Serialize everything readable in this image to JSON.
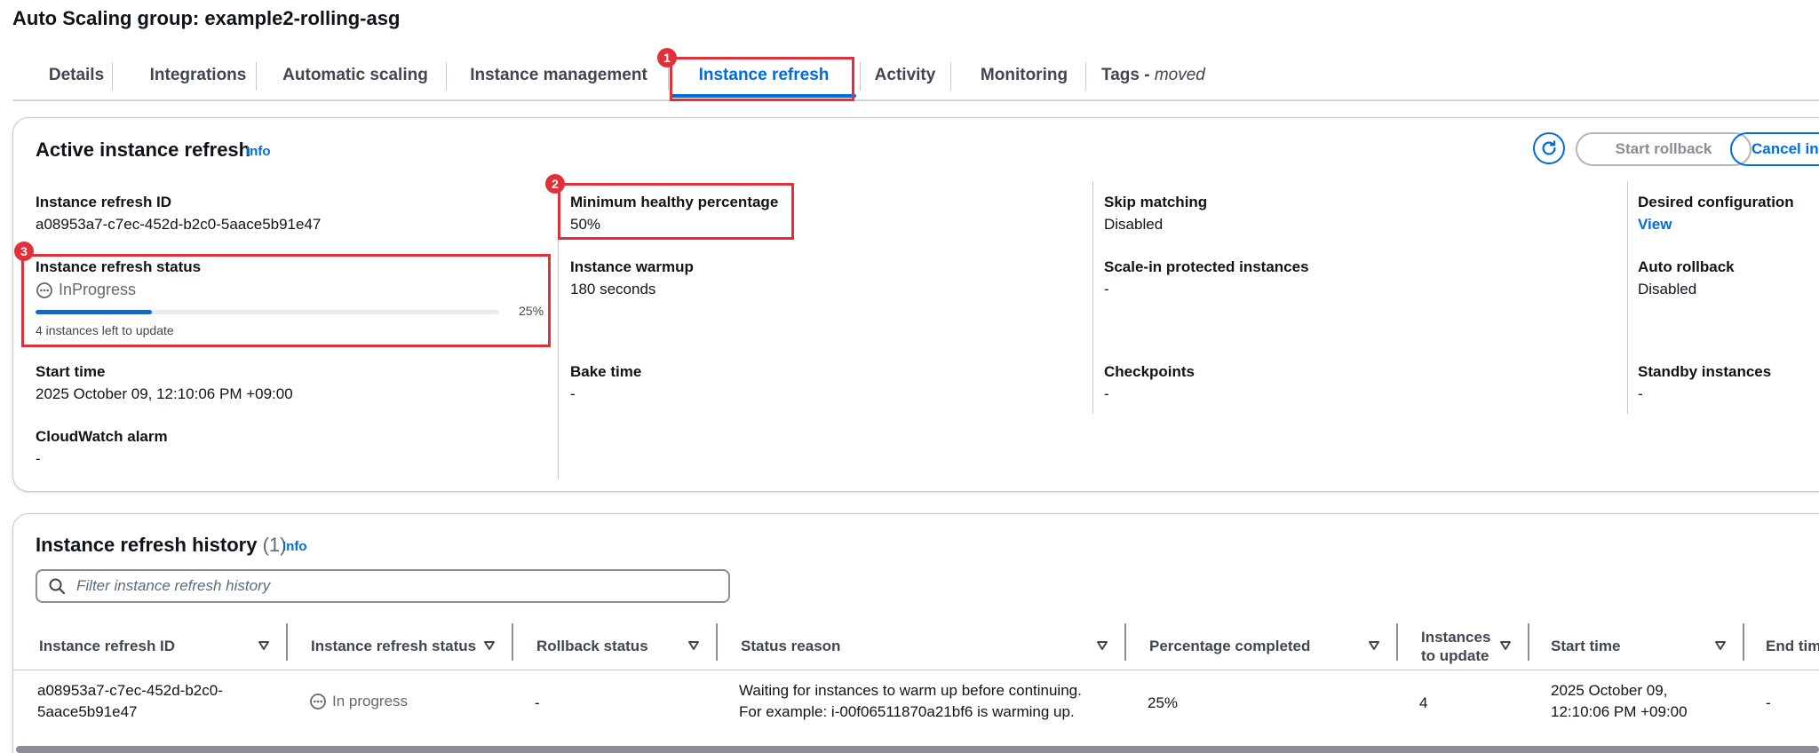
{
  "page": {
    "title": "Auto Scaling group: example2-rolling-asg"
  },
  "tabs": [
    {
      "label": "Details"
    },
    {
      "label": "Integrations"
    },
    {
      "label": "Automatic scaling"
    },
    {
      "label": "Instance management"
    },
    {
      "label": "Instance refresh",
      "active": true
    },
    {
      "label": "Activity"
    },
    {
      "label": "Monitoring"
    },
    {
      "label": "Tags - ",
      "suffix": "moved"
    }
  ],
  "annotations": [
    "1",
    "2",
    "3"
  ],
  "active_refresh": {
    "title": "Active instance refresh",
    "info": "Info",
    "buttons": {
      "start_rollback": "Start rollback",
      "cancel": "Cancel ins"
    },
    "fields": {
      "refresh_id": {
        "label": "Instance refresh ID",
        "value": "a08953a7-c7ec-452d-b2c0-5aace5b91e47"
      },
      "status": {
        "label": "Instance refresh status",
        "value": "InProgress",
        "progress_percent": 25,
        "progress_text": "25%",
        "note": "4 instances left to update"
      },
      "start_time": {
        "label": "Start time",
        "value": "2025 October 09, 12:10:06 PM +09:00"
      },
      "cloudwatch": {
        "label": "CloudWatch alarm",
        "value": "-"
      },
      "min_healthy": {
        "label": "Minimum healthy percentage",
        "value": "50%"
      },
      "warmup": {
        "label": "Instance warmup",
        "value": "180 seconds"
      },
      "bake_time": {
        "label": "Bake time",
        "value": "-"
      },
      "skip_matching": {
        "label": "Skip matching",
        "value": "Disabled"
      },
      "scale_in": {
        "label": "Scale-in protected instances",
        "value": "-"
      },
      "checkpoints": {
        "label": "Checkpoints",
        "value": "-"
      },
      "desired_config": {
        "label": "Desired configuration",
        "value": "View"
      },
      "auto_rollback": {
        "label": "Auto rollback",
        "value": "Disabled"
      },
      "standby": {
        "label": "Standby instances",
        "value": "-"
      }
    }
  },
  "history": {
    "title": "Instance refresh history",
    "count": "(1)",
    "info": "Info",
    "filter_placeholder": "Filter instance refresh history",
    "columns": [
      "Instance refresh ID",
      "Instance refresh status",
      "Rollback status",
      "Status reason",
      "Percentage completed",
      "Instances to update",
      "Start time",
      "End tim"
    ],
    "rows": [
      {
        "id_line1": "a08953a7-c7ec-452d-b2c0-",
        "id_line2": "5aace5b91e47",
        "status": "In progress",
        "rollback": "-",
        "reason_line1": "Waiting for instances to warm up before continuing.",
        "reason_line2": "For example: i-00f06511870a21bf6 is warming up.",
        "percent": "25%",
        "instances": "4",
        "start_line1": "2025 October 09,",
        "start_line2": "12:10:06 PM +09:00",
        "end": "-"
      }
    ]
  }
}
